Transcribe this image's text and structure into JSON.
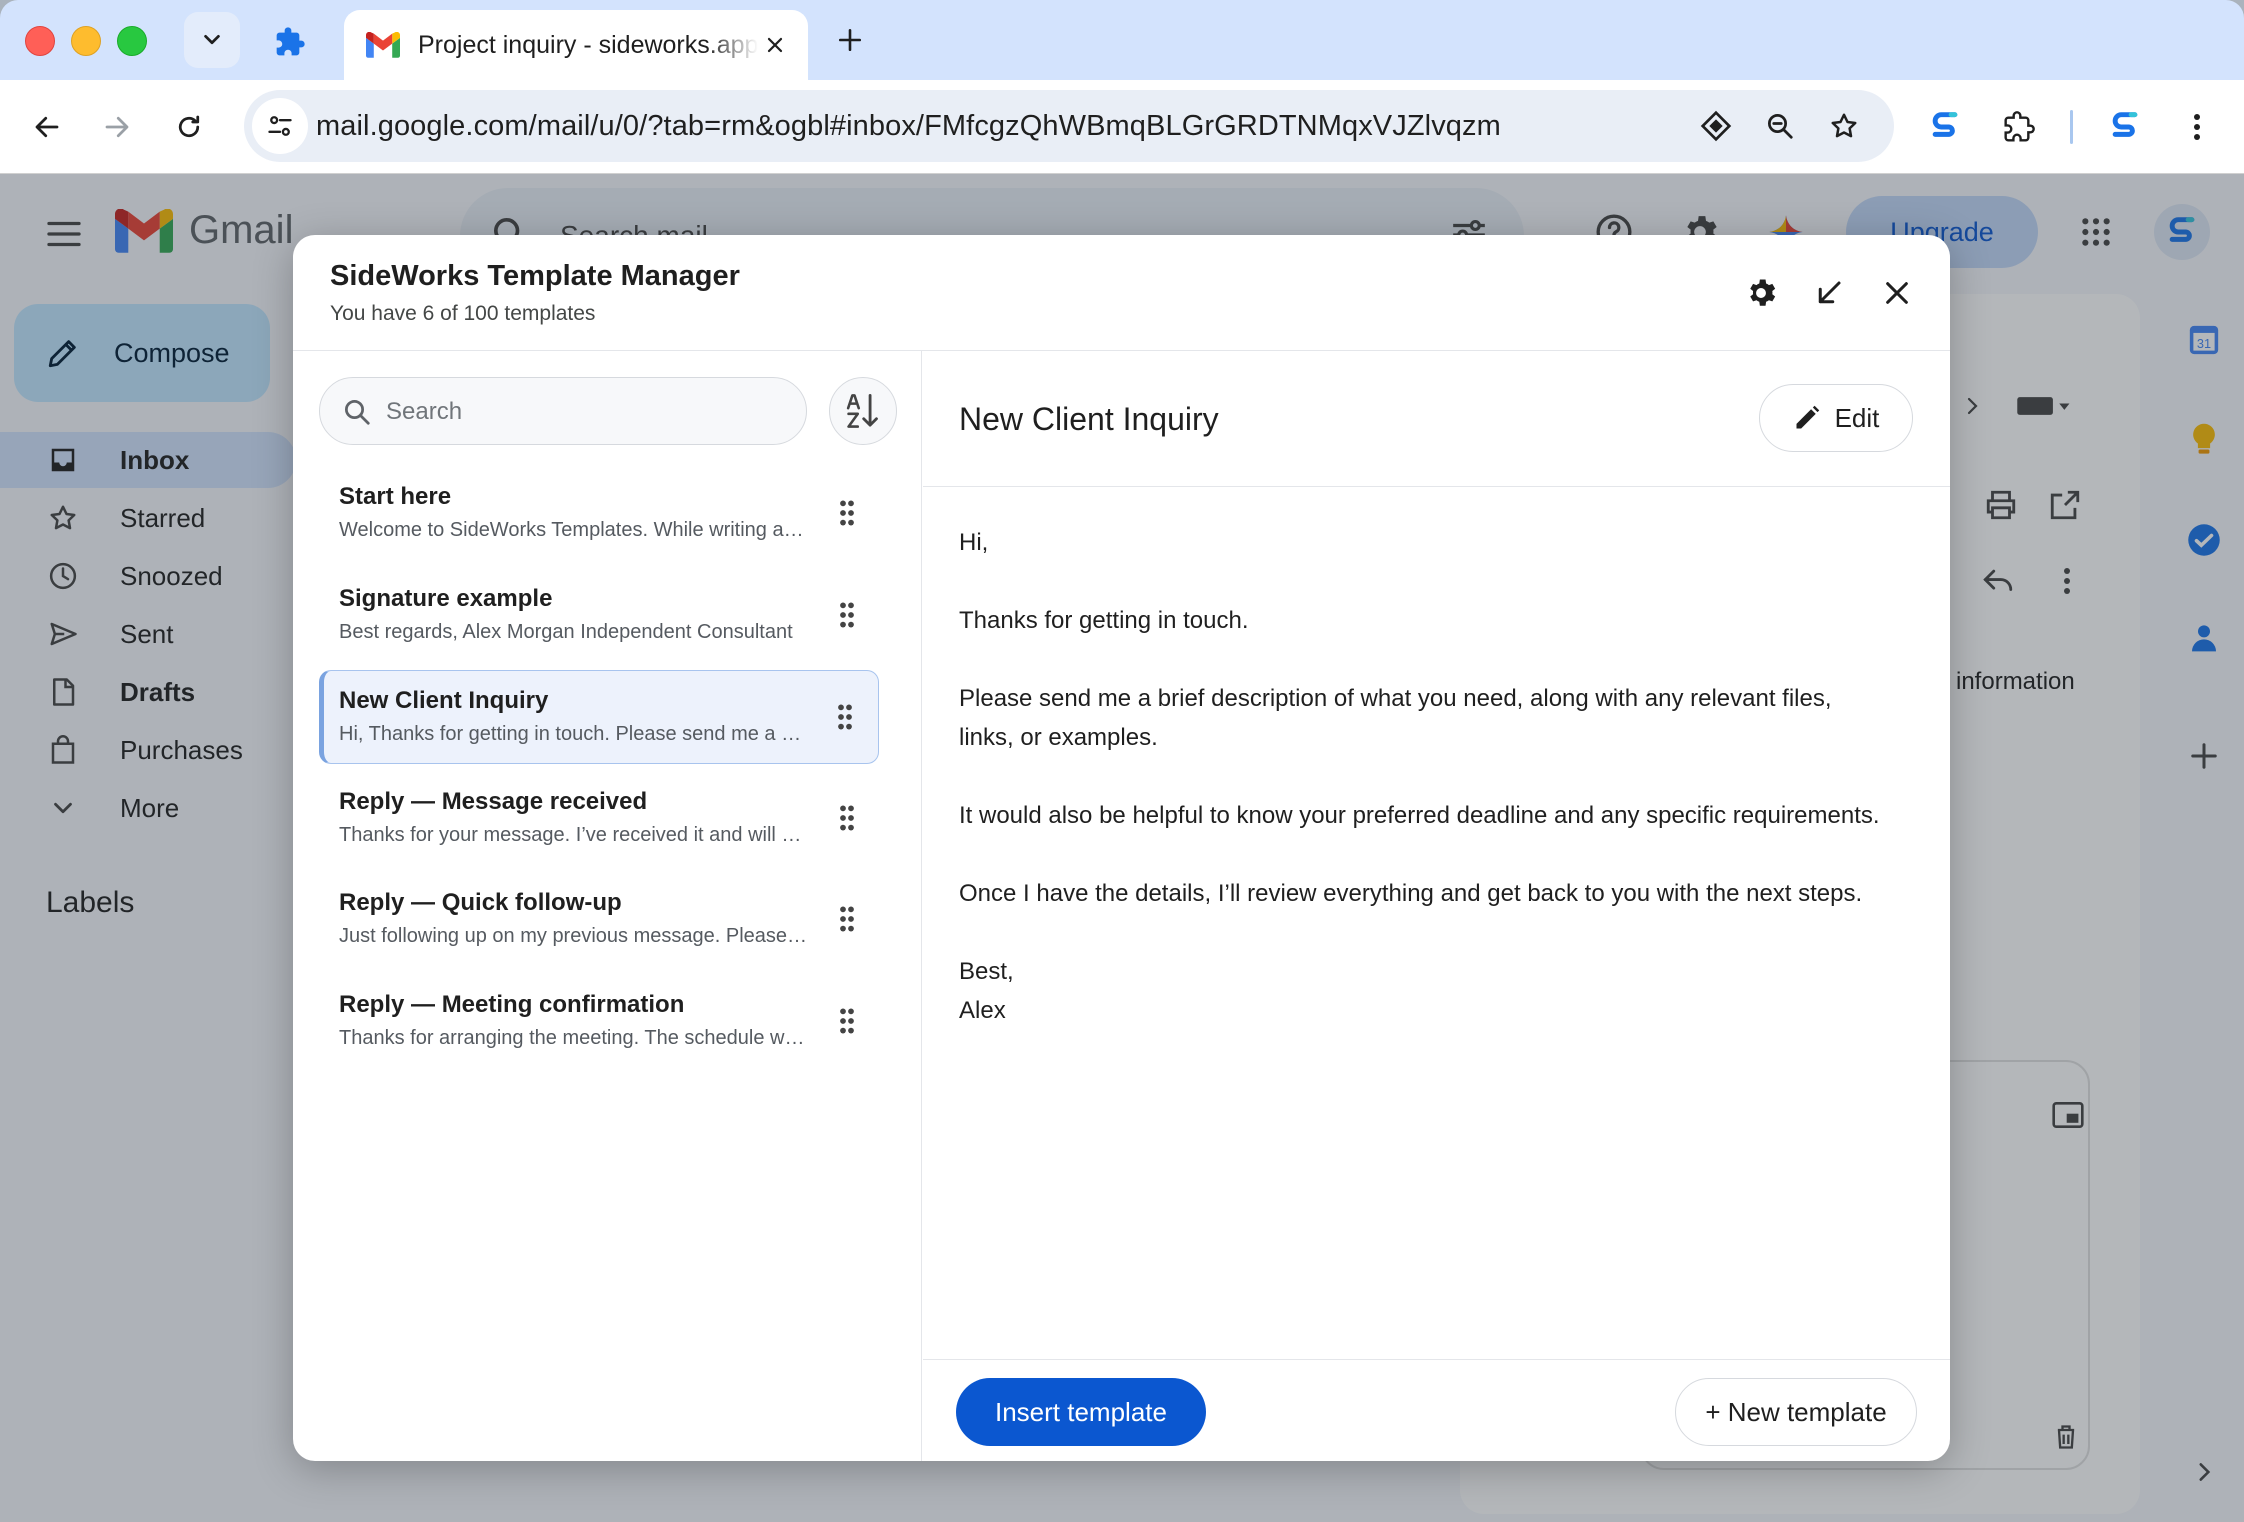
{
  "browser": {
    "tab_title": "Project inquiry - sideworks.app",
    "url": "mail.google.com/mail/u/0/?tab=rm&ogbl#inbox/FMfcgzQhWBmqBLGrGRDTNMqxVJZlvqzm"
  },
  "gmail": {
    "logo_text": "Gmail",
    "search_placeholder": "Search mail",
    "upgrade_label": "Upgrade",
    "compose_label": "Compose",
    "nav": [
      {
        "label": "Inbox",
        "icon": "inbox-icon",
        "active": true,
        "bold": true
      },
      {
        "label": "Starred",
        "icon": "star-icon"
      },
      {
        "label": "Snoozed",
        "icon": "clock-icon"
      },
      {
        "label": "Sent",
        "icon": "send-icon"
      },
      {
        "label": "Drafts",
        "icon": "draft-icon",
        "bold": true
      },
      {
        "label": "Purchases",
        "icon": "shopping-bag-icon"
      },
      {
        "label": "More",
        "icon": "chevron-down-icon"
      }
    ],
    "labels_title": "Labels",
    "background_text": "information",
    "calendar_badge": "31"
  },
  "modal": {
    "title": "SideWorks Template Manager",
    "subtitle": "You have 6 of 100 templates",
    "search_placeholder": "Search",
    "templates": [
      {
        "name": "Start here",
        "preview": "Welcome to SideWorks Templates. While writing an email, click the template icon to insert"
      },
      {
        "name": "Signature example",
        "preview": "Best regards, Alex Morgan Independent Consultant"
      },
      {
        "name": "New Client Inquiry",
        "preview": "Hi, Thanks for getting in touch. Please send me a brief description",
        "selected": true
      },
      {
        "name": "Reply — Message received",
        "preview": "Thanks for your message. I’ve received it and will get back to you"
      },
      {
        "name": "Reply — Quick follow-up",
        "preview": "Just following up on my previous message. Please let me know"
      },
      {
        "name": "Reply — Meeting confirmation",
        "preview": "Thanks for arranging the meeting. The schedule works for me"
      }
    ],
    "selected": {
      "title": "New Client Inquiry",
      "edit_label": "Edit",
      "body": [
        "Hi,",
        "Thanks for getting in touch.",
        "Please send me a brief description of what you need, along with any relevant files, links, or examples.",
        "It would also be helpful to know your preferred deadline and any specific requirements.",
        "Once I have the details, I’ll review everything and get back to you with the next steps.",
        "Best,\nAlex"
      ]
    },
    "insert_label": "Insert template",
    "new_label": "+ New template"
  },
  "colors": {
    "primary": "#0b57d0",
    "selected_bg": "#edf2fc",
    "tabstrip": "#d3e3fd"
  }
}
